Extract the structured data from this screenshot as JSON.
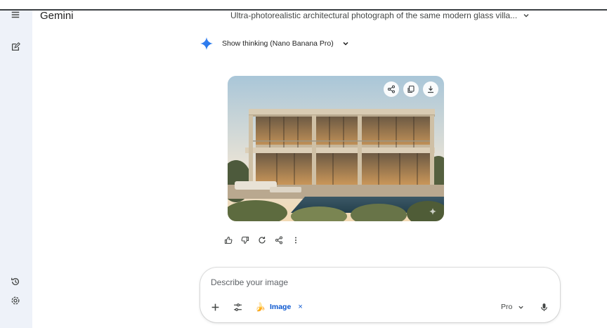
{
  "header": {
    "app_title": "Gemini",
    "chat_title": "Ultra-photorealistic architectural photograph of the same modern glass villa..."
  },
  "sidebar": {
    "top_icons": [
      "menu-icon",
      "new-chat-icon"
    ],
    "bottom_icons": [
      "history-icon",
      "settings-icon"
    ]
  },
  "response": {
    "thinking_label": "Show thinking (Nano Banana Pro)",
    "image_tools": [
      "share-icon",
      "copy-icon",
      "download-icon"
    ],
    "actions": [
      "thumbs-up-icon",
      "thumbs-down-icon",
      "regenerate-icon",
      "share-icon",
      "more-vert-icon"
    ]
  },
  "composer": {
    "placeholder": "Describe your image",
    "value": "",
    "chip_label": "Image",
    "chip_icon": "🍌",
    "chip_close": "×",
    "model": "Pro"
  },
  "colors": {
    "accent": "#0b57d0",
    "sidebar_bg": "#eef2f9",
    "sparkle": "#4285f4"
  }
}
